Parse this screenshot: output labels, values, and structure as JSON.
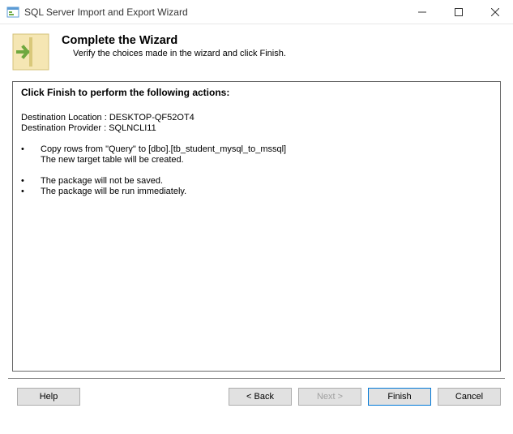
{
  "window": {
    "title": "SQL Server Import and Export Wizard"
  },
  "header": {
    "title": "Complete the Wizard",
    "subtitle": "Verify the choices made in the wizard and click Finish."
  },
  "content": {
    "heading": "Click Finish to perform the following actions:",
    "destination_location": "Destination Location : DESKTOP-QF52OT4",
    "destination_provider": "Destination Provider : SQLNCLI11",
    "actions": {
      "copy_rows": "Copy rows from \"Query\" to [dbo].[tb_student_mysql_to_mssql]",
      "new_table": "The new target table will be created.",
      "not_saved": "The package will not be saved.",
      "run_immediately": "The package will be run immediately."
    }
  },
  "buttons": {
    "help": "Help",
    "back": "< Back",
    "next": "Next >",
    "finish": "Finish",
    "cancel": "Cancel"
  }
}
